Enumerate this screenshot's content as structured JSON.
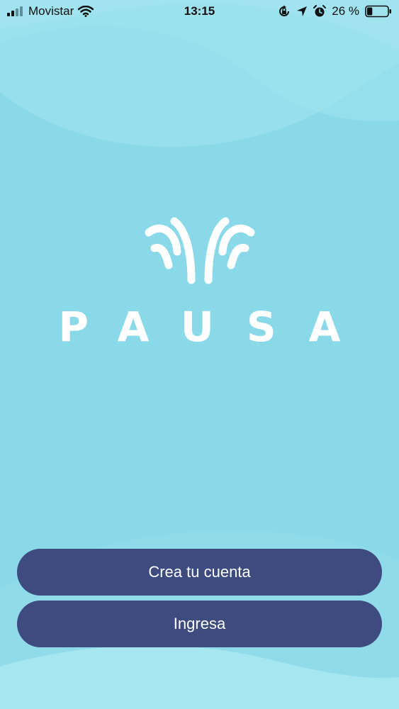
{
  "status_bar": {
    "carrier": "Movistar",
    "time": "13:15",
    "battery_percent": "26 %",
    "battery_level": 0.26,
    "icons": [
      "signal-icon",
      "wifi-icon",
      "orientation-lock-icon",
      "location-icon",
      "alarm-icon",
      "battery-icon"
    ]
  },
  "brand": {
    "name": "PAUSA",
    "logo_icon": "butterfly-logo-icon",
    "color": "#ffffff"
  },
  "actions": {
    "create_account": "Crea tu cuenta",
    "login": "Ingresa"
  },
  "colors": {
    "background": "#8ad9e8",
    "button": "#3d4b7f",
    "button_text": "#ffffff"
  }
}
